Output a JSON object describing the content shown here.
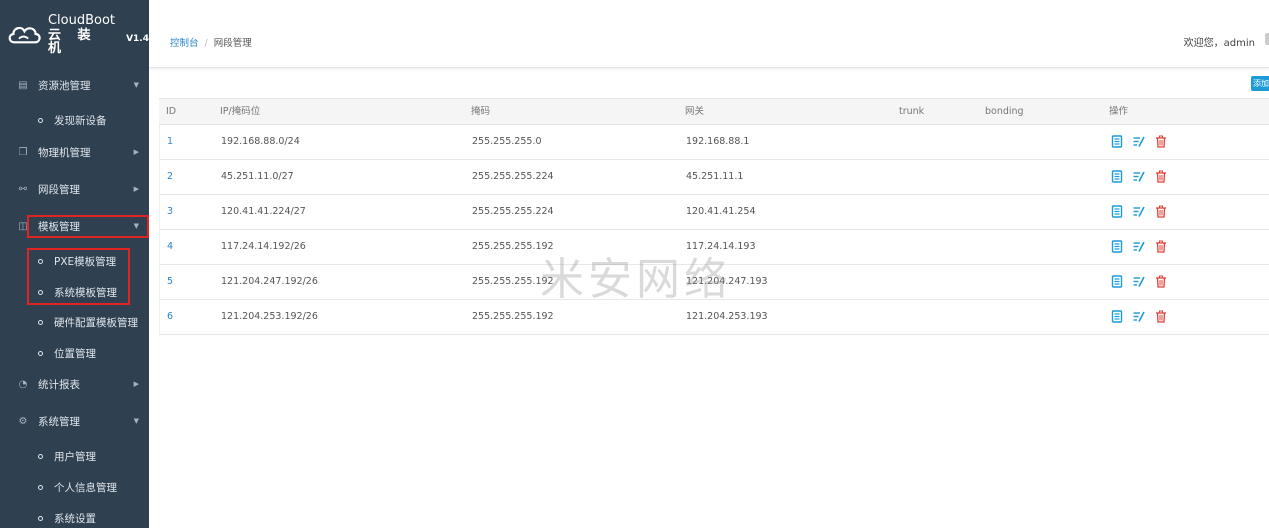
{
  "logo": {
    "brand": "CloudBoot",
    "cn_name": "云 装 机",
    "version": "V1.4"
  },
  "sidebar": {
    "items": [
      {
        "label": "资源池管理",
        "icon": "server-icon"
      },
      {
        "label": "发现新设备",
        "sub": true
      },
      {
        "label": "物理机管理",
        "icon": "copy-icon"
      },
      {
        "label": "网段管理",
        "icon": "link-icon"
      },
      {
        "label": "模板管理",
        "icon": "template-icon"
      },
      {
        "label": "PXE模板管理",
        "sub": true
      },
      {
        "label": "系统模板管理",
        "sub": true
      },
      {
        "label": "硬件配置模板管理",
        "sub": true
      },
      {
        "label": "位置管理",
        "sub": true
      },
      {
        "label": "统计报表",
        "icon": "pie-chart-icon"
      },
      {
        "label": "系统管理",
        "icon": "gear-icon"
      },
      {
        "label": "用户管理",
        "sub": true
      },
      {
        "label": "个人信息管理",
        "sub": true
      },
      {
        "label": "系统设置",
        "sub": true
      }
    ]
  },
  "header": {
    "breadcrumb": [
      "控制台",
      "/",
      "网段管理"
    ],
    "welcome": "欢迎您，admin"
  },
  "toolbar": {
    "add_label": "添加"
  },
  "table": {
    "columns": [
      "ID",
      "IP/掩码位",
      "掩码",
      "网关",
      "trunk",
      "bonding",
      "操作"
    ],
    "rows": [
      {
        "id": "1",
        "ip": "192.168.88.0/24",
        "mask": "255.255.255.0",
        "gateway": "192.168.88.1",
        "trunk": "",
        "bonding": ""
      },
      {
        "id": "2",
        "ip": "45.251.11.0/27",
        "mask": "255.255.255.224",
        "gateway": "45.251.11.1",
        "trunk": "",
        "bonding": ""
      },
      {
        "id": "3",
        "ip": "120.41.41.224/27",
        "mask": "255.255.255.224",
        "gateway": "120.41.41.254",
        "trunk": "",
        "bonding": ""
      },
      {
        "id": "4",
        "ip": "117.24.14.192/26",
        "mask": "255.255.255.192",
        "gateway": "117.24.14.193",
        "trunk": "",
        "bonding": ""
      },
      {
        "id": "5",
        "ip": "121.204.247.192/26",
        "mask": "255.255.255.192",
        "gateway": "121.204.247.193",
        "trunk": "",
        "bonding": ""
      },
      {
        "id": "6",
        "ip": "121.204.253.192/26",
        "mask": "255.255.255.192",
        "gateway": "121.204.253.193",
        "trunk": "",
        "bonding": ""
      }
    ]
  },
  "watermark": "米安网络",
  "colors": {
    "sidebar_bg": "#2f4050",
    "accent": "#1c9bd7",
    "link": "#2a84c9",
    "highlight": "#e02424",
    "delete": "#e0403a"
  }
}
